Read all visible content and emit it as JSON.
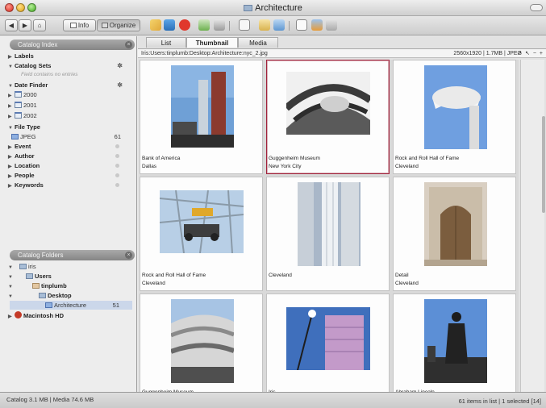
{
  "window": {
    "title": "Architecture"
  },
  "toolbar": {
    "info_label": "Info",
    "organize_label": "Organize"
  },
  "catalog_index": {
    "header": "Catalog Index",
    "rows": {
      "labels": "Labels",
      "catalog_sets": "Catalog Sets",
      "catalog_sets_hint": "Field contains no entries",
      "date_finder": "Date Finder",
      "y2000": "2000",
      "y2001": "2001",
      "y2002": "2002",
      "file_type": "File Type",
      "jpeg": "JPEG",
      "jpeg_count": "61",
      "event": "Event",
      "author": "Author",
      "location": "Location",
      "people": "People",
      "keywords": "Keywords"
    }
  },
  "catalog_folders": {
    "header": "Catalog Folders",
    "rows": {
      "iris": "iris",
      "users": "Users",
      "user": "tinplumb",
      "desktop": "Desktop",
      "architecture": "Architecture",
      "architecture_count": "51",
      "macintosh": "Macintosh HD"
    }
  },
  "tabs": [
    "List",
    "Thumbnail",
    "Media"
  ],
  "pathbar": {
    "path": "Iris:Users:tinplumb:Desktop:Architecture:nyc_2.jpg",
    "meta": "2560x1920 | 1.7MB | JPEG",
    "controls": "↗ ↖ − +"
  },
  "thumbnails": [
    {
      "caption": "Bank of America",
      "subcaption": "Dallas",
      "scene": "towers"
    },
    {
      "caption": "Guggenheim Museum",
      "subcaption": "New York City",
      "scene": "spiral"
    },
    {
      "caption": "Rock and Roll Hall of Fame",
      "subcaption": "Cleveland",
      "scene": "disc"
    },
    {
      "caption": "Rock and Roll Hall of Fame",
      "subcaption": "Cleveland",
      "scene": "trusses"
    },
    {
      "caption": "Cleveland",
      "subcaption": "",
      "scene": "columns"
    },
    {
      "caption": "Detail",
      "subcaption": "Cleveland",
      "scene": "doorway"
    },
    {
      "caption": "Guggenheim Museum",
      "subcaption": "",
      "scene": "curves"
    },
    {
      "caption": "Iris",
      "subcaption": "",
      "scene": "streetlamp"
    },
    {
      "caption": "Abraham Lincoln",
      "subcaption": "",
      "scene": "statue"
    }
  ],
  "status": {
    "left": "Catalog  3.1 MB  |  Media 74.6 MB",
    "right": "61 items in list  |  1 selected [14]"
  }
}
